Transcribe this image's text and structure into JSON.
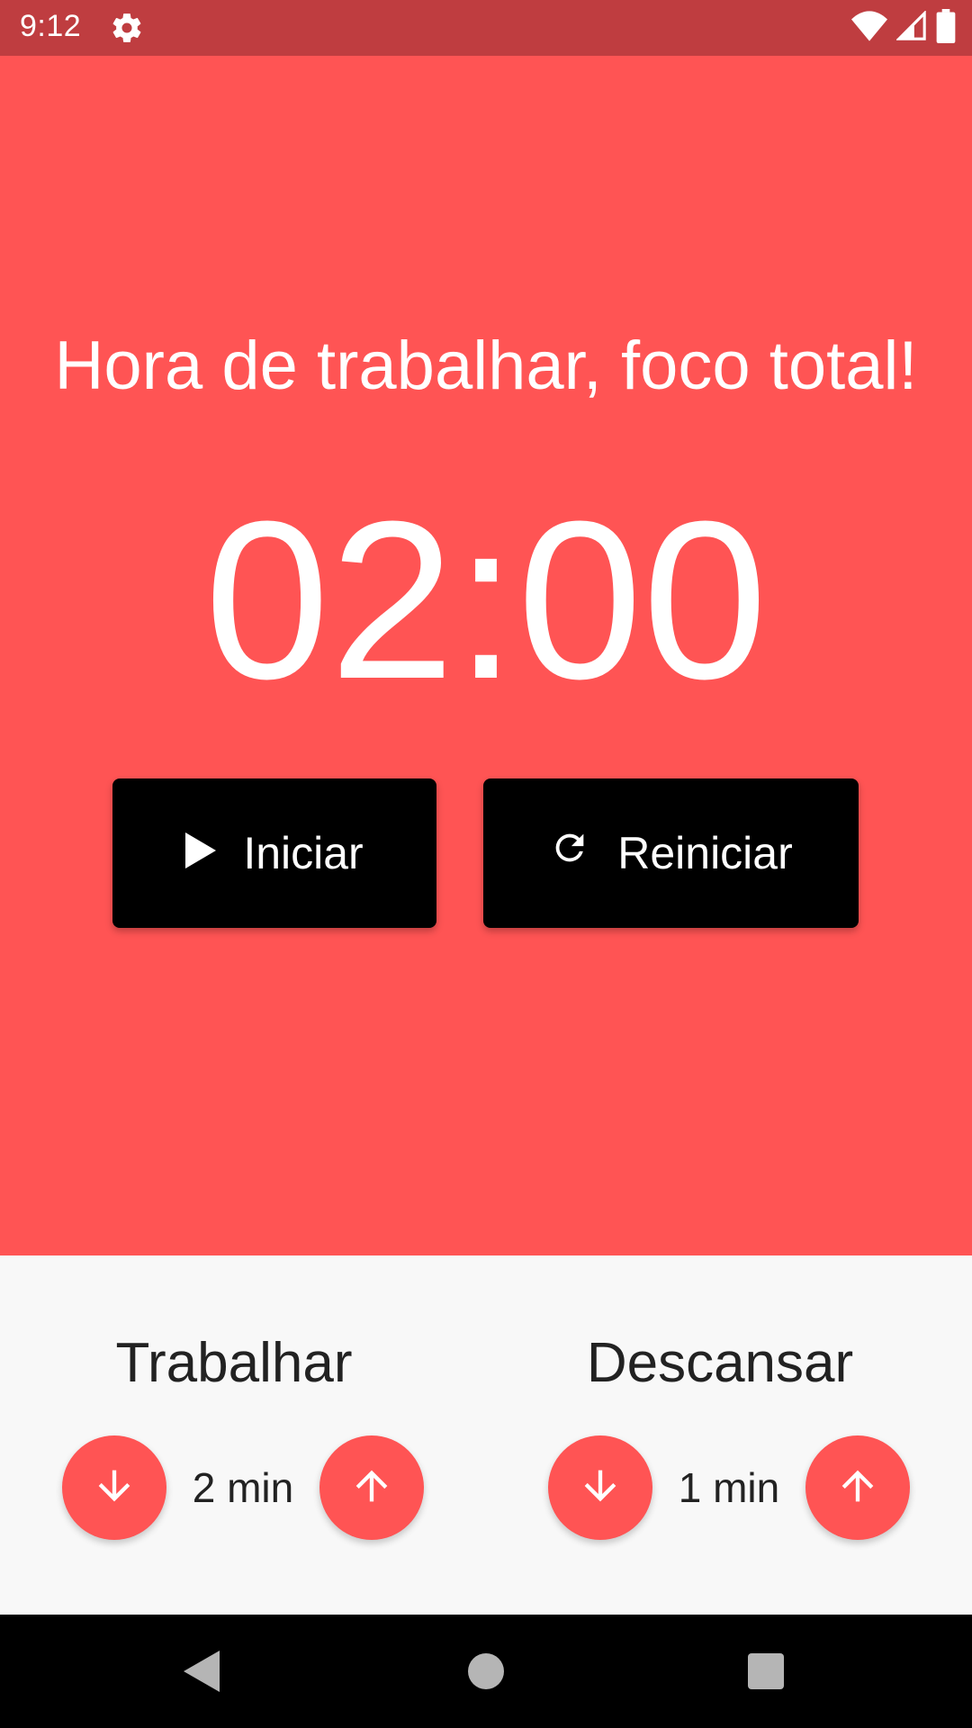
{
  "status_bar": {
    "time": "9:12",
    "color": "#bf3d40",
    "icons": [
      "gear-icon",
      "wifi-icon",
      "signal-icon",
      "battery-icon"
    ]
  },
  "main": {
    "background": "#ff5454",
    "headline": "Hora de trabalhar, foco total!",
    "timer": "02:00",
    "start_button": {
      "label": "Iniciar",
      "icon": "play-icon"
    },
    "reset_button": {
      "label": "Reiniciar",
      "icon": "refresh-icon"
    }
  },
  "settings": {
    "work": {
      "title": "Trabalhar",
      "value": "2 min",
      "decrease_icon": "arrow-down-icon",
      "increase_icon": "arrow-up-icon"
    },
    "rest": {
      "title": "Descansar",
      "value": "1 min",
      "decrease_icon": "arrow-down-icon",
      "increase_icon": "arrow-up-icon"
    }
  },
  "nav_bar": {
    "buttons": [
      "back-icon",
      "home-icon",
      "recents-icon"
    ]
  }
}
